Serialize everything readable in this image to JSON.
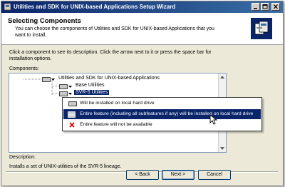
{
  "window": {
    "title": "Utilities and SDK for UNIX-based Applications Setup Wizard",
    "controls": {
      "minimize": "minimize-icon",
      "maximize": "maximize-icon",
      "close": "close-icon"
    }
  },
  "header": {
    "title": "Selecting Components",
    "subtitle": "You can choose the components of Utilities and SDK for UNIX-based Applications that you want to install."
  },
  "instructions": "Click a component to see its description. Click the arrow next to it or press the space bar for installation options.",
  "components_label": "Components:",
  "tree": {
    "root": "Utilities and SDK for UNIX-based Applications",
    "children": [
      "Base Utilities",
      "SVR-5 Utilities"
    ],
    "selected": "SVR-5 Utilities"
  },
  "dropdown": {
    "items": [
      {
        "icon": "drive-icon",
        "label": "Will be installed on local hard drive"
      },
      {
        "icon": "drive-stack-icon",
        "label": "Entire feature (including all subfeatures if any) will be installed on local hard drive"
      },
      {
        "icon": "red-x-icon",
        "label": "Entire feature will not be available"
      }
    ],
    "highlighted_index": 1
  },
  "description": {
    "label": "Description:",
    "text": "Installs a set of UNIX-utilities of the SVR-5 lineage."
  },
  "buttons": {
    "back": "< Back",
    "next": "Next >",
    "cancel": "Cancel"
  },
  "colors": {
    "titlebar": "#0a246a",
    "highlight": "#0a246a",
    "background": "#ece9d8",
    "red_x": "#cc0000"
  }
}
